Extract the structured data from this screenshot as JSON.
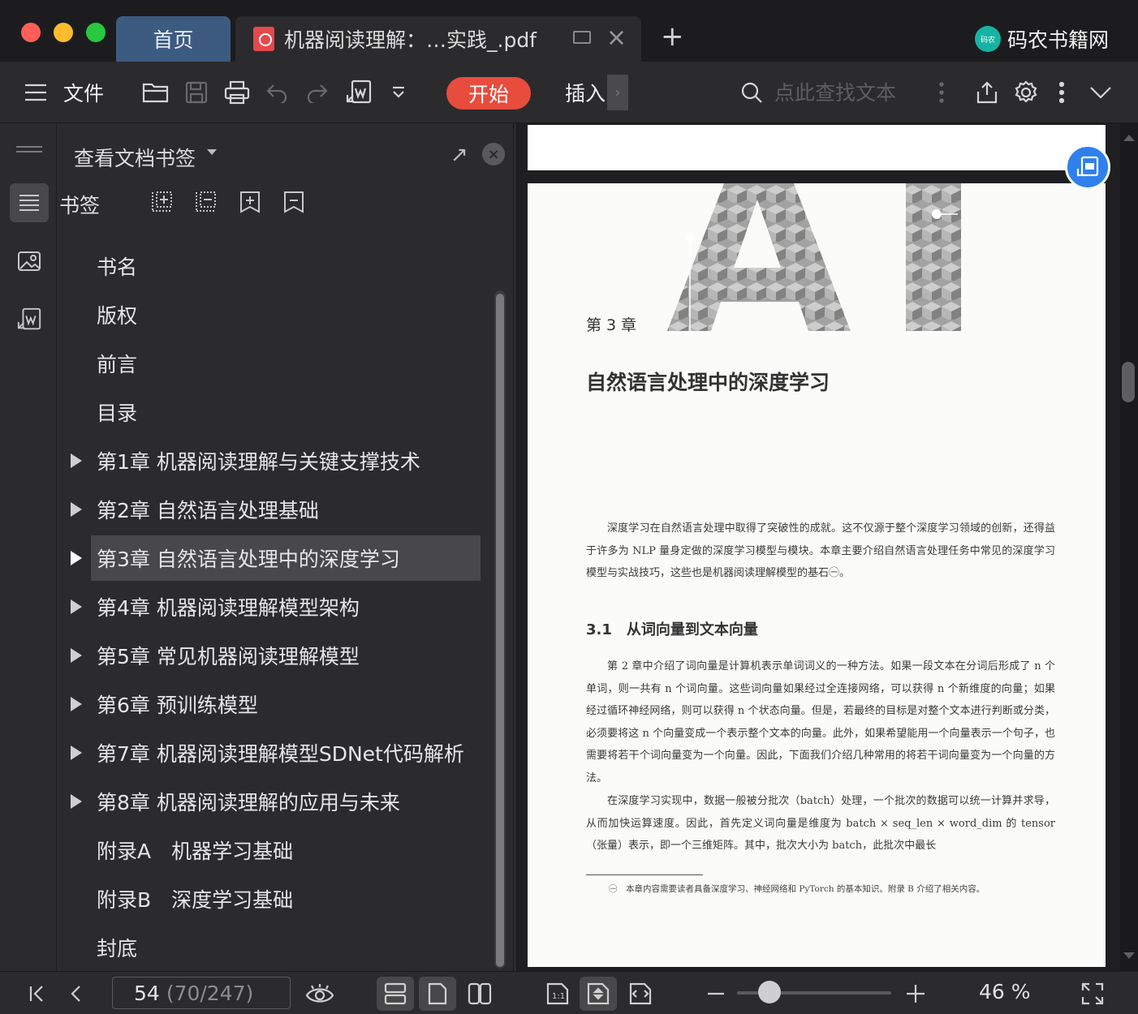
{
  "window": {
    "tabs": [
      {
        "label": "首页"
      },
      {
        "label": "机器阅读理解：…实践_.pdf"
      }
    ],
    "brand": "码农书籍网",
    "brand_logo_text": "码农"
  },
  "toolbar": {
    "menu_label": "文件",
    "start_label": "开始",
    "insert_label": "插入",
    "search_placeholder": "点此查找文本"
  },
  "bookmark_panel": {
    "title": "查看文档书签",
    "section_label": "书签",
    "items": [
      {
        "label": "书名",
        "expandable": false
      },
      {
        "label": "版权",
        "expandable": false
      },
      {
        "label": "前言",
        "expandable": false
      },
      {
        "label": "目录",
        "expandable": false
      },
      {
        "label": "第1章 机器阅读理解与关键支撑技术",
        "expandable": true
      },
      {
        "label": "第2章 自然语言处理基础",
        "expandable": true
      },
      {
        "label": "第3章 自然语言处理中的深度学习",
        "expandable": true,
        "selected": true
      },
      {
        "label": "第4章 机器阅读理解模型架构",
        "expandable": true
      },
      {
        "label": "第5章 常见机器阅读理解模型",
        "expandable": true
      },
      {
        "label": "第6章 预训练模型",
        "expandable": true
      },
      {
        "label": "第7章 机器阅读理解模型SDNet代码解析",
        "expandable": true
      },
      {
        "label": "第8章 机器阅读理解的应用与未来",
        "expandable": true
      },
      {
        "label": "附录A　机器学习基础",
        "expandable": false
      },
      {
        "label": "附录B　深度学习基础",
        "expandable": false
      },
      {
        "label": "封底",
        "expandable": false
      }
    ]
  },
  "document": {
    "chapter_number": "第 3 章",
    "chapter_title": "自然语言处理中的深度学习",
    "intro": "深度学习在自然语言处理中取得了突破性的成就。这不仅源于整个深度学习领域的创新，还得益于许多为 NLP 量身定做的深度学习模型与模块。本章主要介绍自然语言处理任务中常见的深度学习模型与实战技巧，这些也是机器阅读理解模型的基石㊀。",
    "section_title": "3.1　从词向量到文本向量",
    "para1": "第 2 章中介绍了词向量是计算机表示单词词义的一种方法。如果一段文本在分词后形成了 n 个单词，则一共有 n 个词向量。这些词向量如果经过全连接网络，可以获得 n 个新维度的向量；如果经过循环神经网络，则可以获得 n 个状态向量。但是，若最终的目标是对整个文本进行判断或分类，必须要将这 n 个向量变成一个表示整个文本的向量。此外，如果希望能用一个向量表示一个句子，也需要将若干个词向量变为一个向量。因此，下面我们介绍几种常用的将若干词向量变为一个向量的方法。",
    "para2": "在深度学习实现中，数据一般被分批次（batch）处理，一个批次的数据可以统一计算并求导，从而加快运算速度。因此，首先定义词向量是维度为 batch × seq_len × word_dim 的 tensor（张量）表示，即一个三维矩阵。其中，批次大小为 batch，此批次中最长",
    "footnote": "㊀　本章内容需要读者具备深度学习、神经网络和 PyTorch 的基本知识。附录 B 介绍了相关内容。"
  },
  "statusbar": {
    "current_page": "54",
    "page_info": "(70/247)",
    "zoom": "46 %",
    "zoom_fraction": 0.21
  },
  "colors": {
    "accent": "#e84c3d",
    "home_tab": "#3d5a80",
    "float_button": "#2f80ed",
    "brand_logo": "#16b3a4"
  }
}
